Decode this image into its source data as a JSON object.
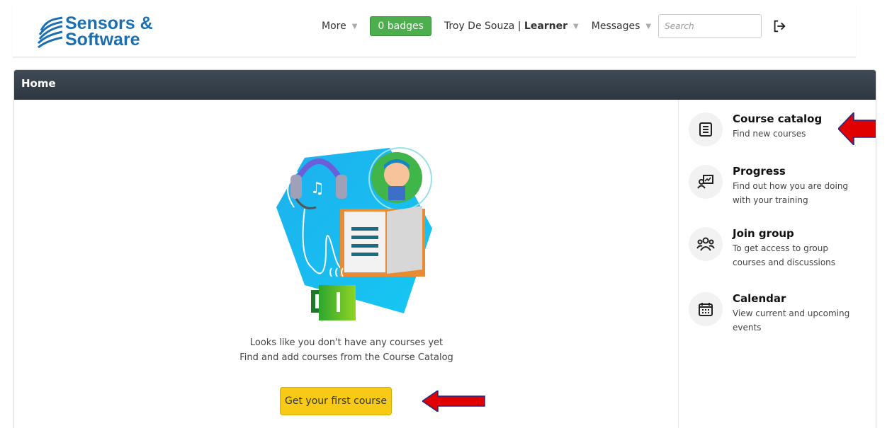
{
  "header": {
    "logo_line1": "Sensors &",
    "logo_line2": "Software",
    "more_label": "More",
    "badges_label": "0 badges",
    "user_name": "Troy De Souza | ",
    "user_role": "Learner",
    "messages_label": "Messages",
    "search_placeholder": "Search"
  },
  "panel": {
    "title": "Home"
  },
  "main": {
    "empty_line1": "Looks like you don't have any courses yet",
    "empty_line2": "Find and add courses from the Course Catalog",
    "cta_label": "Get your first course"
  },
  "sidebar": {
    "items": [
      {
        "title": "Course catalog",
        "desc": "Find new courses",
        "icon": "book-icon"
      },
      {
        "title": "Progress",
        "desc": "Find out how you are doing with your training",
        "icon": "progress-icon"
      },
      {
        "title": "Join group",
        "desc": "To get access to group courses and discussions",
        "icon": "group-icon"
      },
      {
        "title": "Calendar",
        "desc": "View current and upcoming events",
        "icon": "calendar-icon"
      }
    ]
  },
  "colors": {
    "brand": "#1a6fb3",
    "badge": "#4cae4c",
    "cta": "#f7cb15",
    "annotation_arrow": "#e00000"
  }
}
